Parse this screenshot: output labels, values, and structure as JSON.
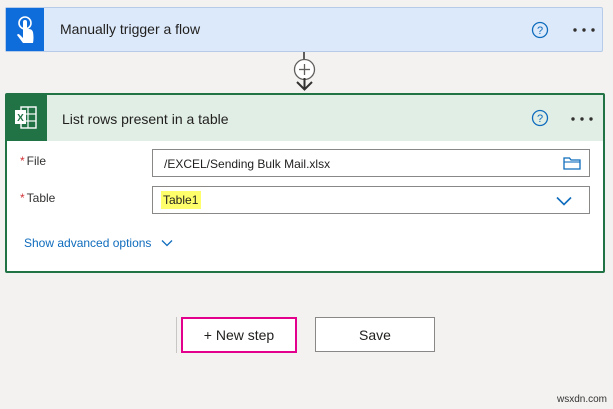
{
  "trigger": {
    "title": "Manually trigger a flow",
    "icon": "touch-hand-icon",
    "accent": "#0f6cdb"
  },
  "action": {
    "title": "List rows present in a table",
    "icon": "excel-icon",
    "accent": "#217346",
    "fields": [
      {
        "label": "File",
        "required_mark": "*",
        "value": "/EXCEL/Sending Bulk Mail.xlsx",
        "control": "folder-picker"
      },
      {
        "label": "Table",
        "required_mark": "*",
        "value": "Table1",
        "control": "dropdown"
      }
    ],
    "advanced_label": "Show advanced options"
  },
  "buttons": {
    "new_step": "+ New step",
    "save": "Save"
  },
  "watermark": "wsxdn.com"
}
